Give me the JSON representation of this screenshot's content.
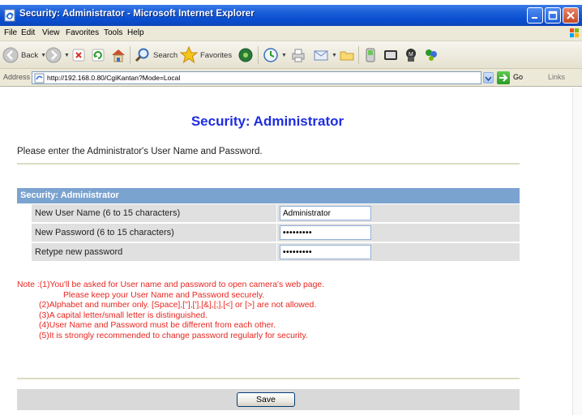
{
  "window": {
    "title": "Security: Administrator - Microsoft Internet Explorer"
  },
  "menu": [
    {
      "label": "File"
    },
    {
      "label": "Edit"
    },
    {
      "label": "View"
    },
    {
      "label": "Favorites"
    },
    {
      "label": "Tools"
    },
    {
      "label": "Help"
    }
  ],
  "toolbar": {
    "back_label": "Back",
    "search_label": "Search",
    "favorites_label": "Favorites"
  },
  "address": {
    "label": "Address",
    "url": "http://192.168.0.80/CgiKantan?Mode=Local",
    "go_label": "Go",
    "links_label": "Links"
  },
  "page": {
    "heading": "Security: Administrator",
    "intro": "Please enter the Administrator's User Name and Password.",
    "section_title": "Security: Administrator",
    "fields": [
      {
        "label": "New User Name (6 to 15 characters)",
        "value": "Administrator",
        "type": "text"
      },
      {
        "label": "New Password (6 to 15 characters)",
        "value": "•••••••••",
        "type": "password"
      },
      {
        "label": "Retype new password",
        "value": "•••••••••",
        "type": "password"
      }
    ],
    "notes": [
      "Note :(1)You'll be asked for User name and password to open camera's web page.",
      "Please keep your User Name and Password securely.",
      "(2)Alphabet and number only. [Space],[\"],['],[&],[;],[<] or [>] are not allowed.",
      "(3)A capital letter/small letter is distinguished.",
      "(4)User Name and Password must be different from each other.",
      "(5)It is strongly recommended to change password regularly for security."
    ],
    "save_label": "Save"
  },
  "colors": {
    "titlebar": "#0a4ed0",
    "heading": "#1f2de0",
    "section_header": "#7ba3d0",
    "note_text": "#e8261f",
    "row_background": "#e0e0e0"
  }
}
